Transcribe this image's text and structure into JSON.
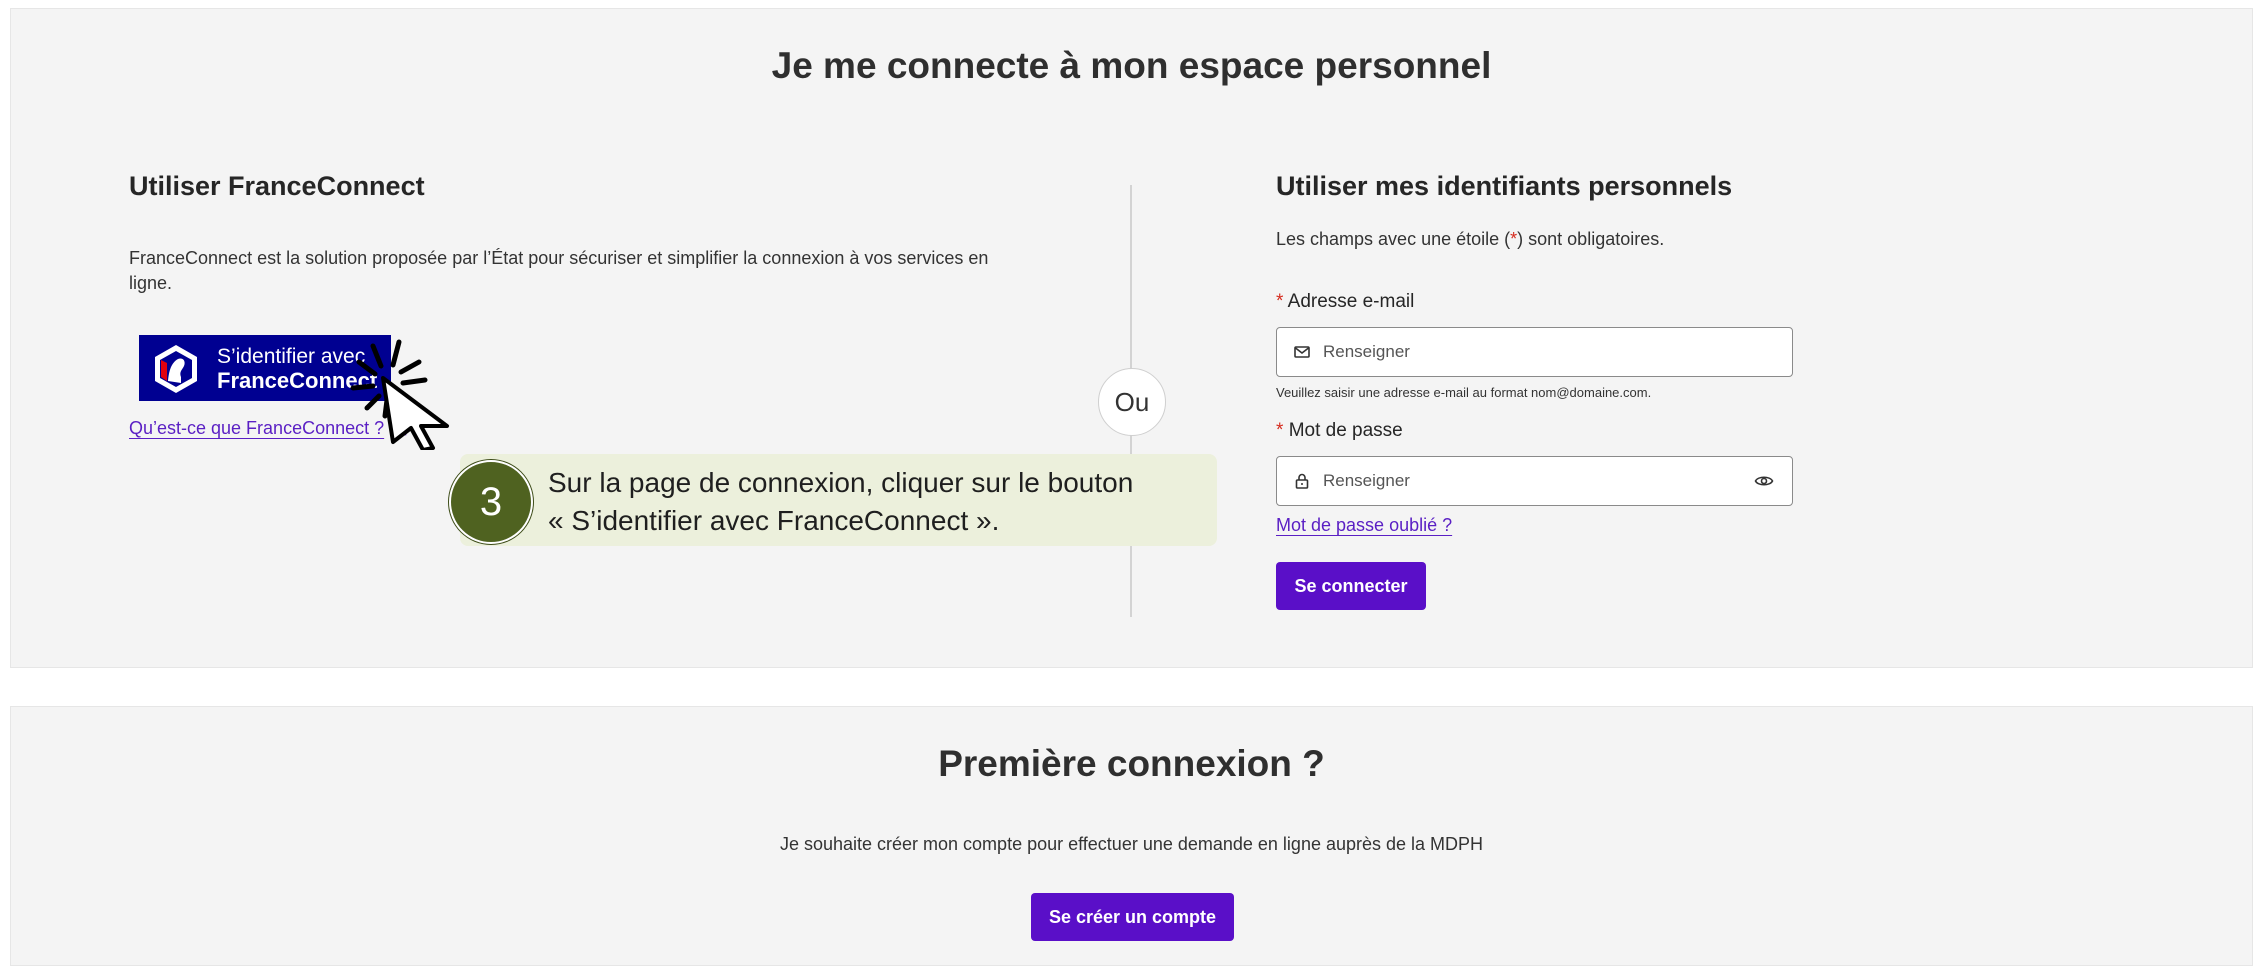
{
  "login": {
    "title": "Je me connecte à mon espace personnel",
    "franceconnect": {
      "heading": "Utiliser FranceConnect",
      "description_line1": "FranceConnect est la solution proposée par l’État pour sécuriser et simplifier la connexion à vos services en",
      "description_line2": "ligne.",
      "button_line1": "S’identifier avec",
      "button_line2": "FranceConnect",
      "what_is_link": "Qu’est-ce que FranceConnect ?"
    },
    "separator": "Ou",
    "credentials": {
      "heading": "Utiliser mes identifiants personnels",
      "required_note_before": "Les champs avec une étoile (",
      "required_star": "*",
      "required_note_after": ") sont obligatoires.",
      "email_star": "*",
      "email_label": "Adresse e-mail",
      "email_placeholder": "Renseigner",
      "email_hint": "Veuillez saisir une adresse e-mail au format nom@domaine.com.",
      "password_star": "*",
      "password_label": "Mot de passe",
      "password_placeholder": "Renseigner",
      "forgot_link": "Mot de passe oublié ?",
      "submit_label": "Se connecter"
    }
  },
  "first_connection": {
    "title": "Première connexion ?",
    "description": "Je souhaite créer mon compte pour effectuer une demande en ligne auprès de la MDPH",
    "create_label": "Se créer un compte"
  },
  "callout": {
    "step_number": "3",
    "text_line1": "Sur la page de connexion, cliquer sur le bouton",
    "text_line2": "« S’identifier avec FranceConnect »."
  },
  "icons": {
    "email": "envelope-icon",
    "password": "lock-icon",
    "show_password": "eye-icon",
    "external_link": "external-link-icon",
    "cursor": "click-cursor-icon"
  },
  "colors": {
    "primary": "#5a0fc8",
    "franceconnect_blue": "#000091",
    "required": "#d52b1e",
    "callout_bg": "#ecf0dc",
    "step_badge": "#4f6220"
  }
}
